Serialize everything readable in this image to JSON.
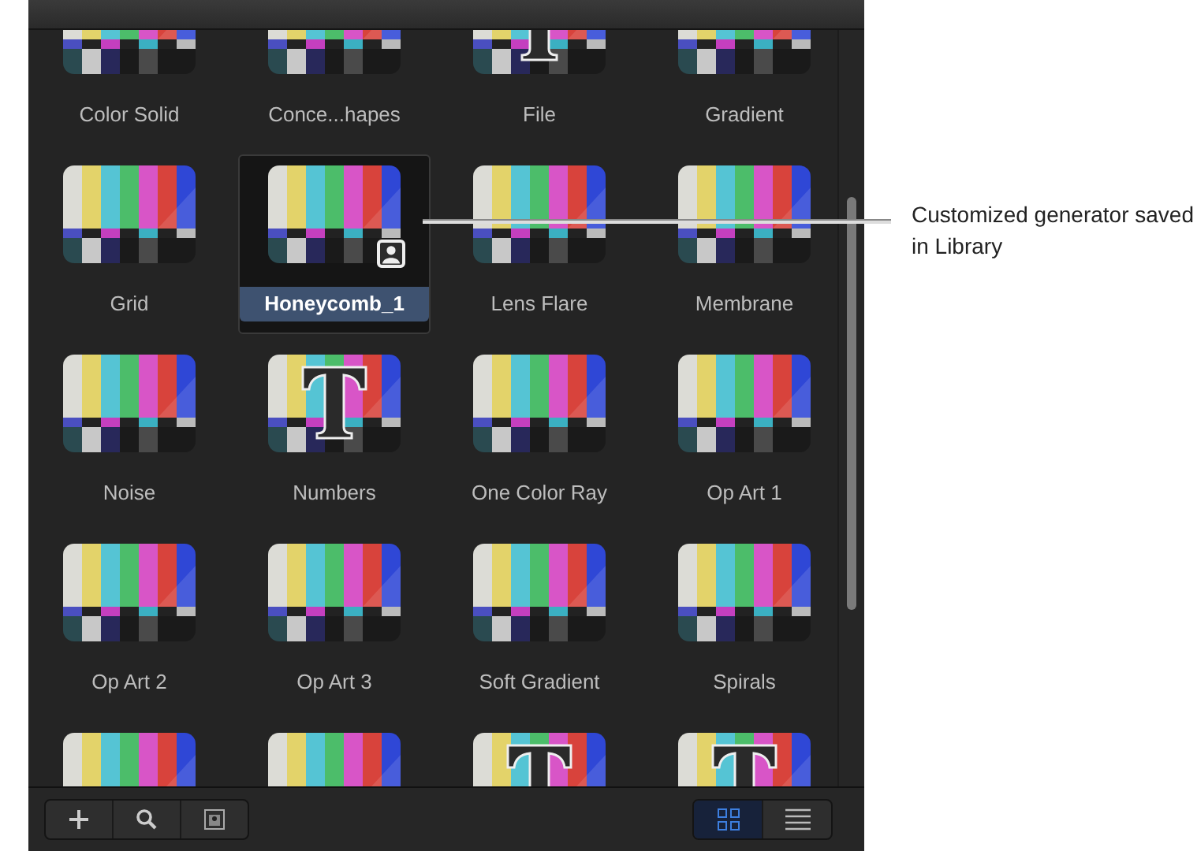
{
  "browser": {
    "rows": [
      [
        {
          "label": "Color Solid",
          "kind": "bars",
          "selected": false,
          "custom": false
        },
        {
          "label": "Conce...hapes",
          "kind": "bars",
          "selected": false,
          "custom": false
        },
        {
          "label": "File",
          "kind": "text",
          "selected": false,
          "custom": false
        },
        {
          "label": "Gradient",
          "kind": "bars",
          "selected": false,
          "custom": false
        }
      ],
      [
        {
          "label": "Grid",
          "kind": "bars",
          "selected": false,
          "custom": false
        },
        {
          "label": "Honeycomb_1",
          "kind": "bars",
          "selected": true,
          "custom": true
        },
        {
          "label": "Lens Flare",
          "kind": "bars",
          "selected": false,
          "custom": false
        },
        {
          "label": "Membrane",
          "kind": "bars",
          "selected": false,
          "custom": false
        }
      ],
      [
        {
          "label": "Noise",
          "kind": "bars",
          "selected": false,
          "custom": false
        },
        {
          "label": "Numbers",
          "kind": "text",
          "selected": false,
          "custom": false
        },
        {
          "label": "One Color Ray",
          "kind": "bars",
          "selected": false,
          "custom": false
        },
        {
          "label": "Op Art 1",
          "kind": "bars",
          "selected": false,
          "custom": false
        }
      ],
      [
        {
          "label": "Op Art 2",
          "kind": "bars",
          "selected": false,
          "custom": false
        },
        {
          "label": "Op Art 3",
          "kind": "bars",
          "selected": false,
          "custom": false
        },
        {
          "label": "Soft Gradient",
          "kind": "bars",
          "selected": false,
          "custom": false
        },
        {
          "label": "Spirals",
          "kind": "bars",
          "selected": false,
          "custom": false
        }
      ],
      [
        {
          "kind": "bars",
          "selected": false
        },
        {
          "kind": "bars",
          "selected": false
        },
        {
          "kind": "text",
          "selected": false
        },
        {
          "kind": "text",
          "selected": false
        }
      ]
    ]
  },
  "toolbar": {
    "actions": [
      {
        "kind": "add"
      },
      {
        "kind": "search"
      },
      {
        "kind": "preview"
      }
    ],
    "views": [
      {
        "kind": "grid",
        "selected": true
      },
      {
        "kind": "list",
        "selected": false
      }
    ]
  },
  "callout": {
    "text": "Customized generator saved in Library"
  }
}
